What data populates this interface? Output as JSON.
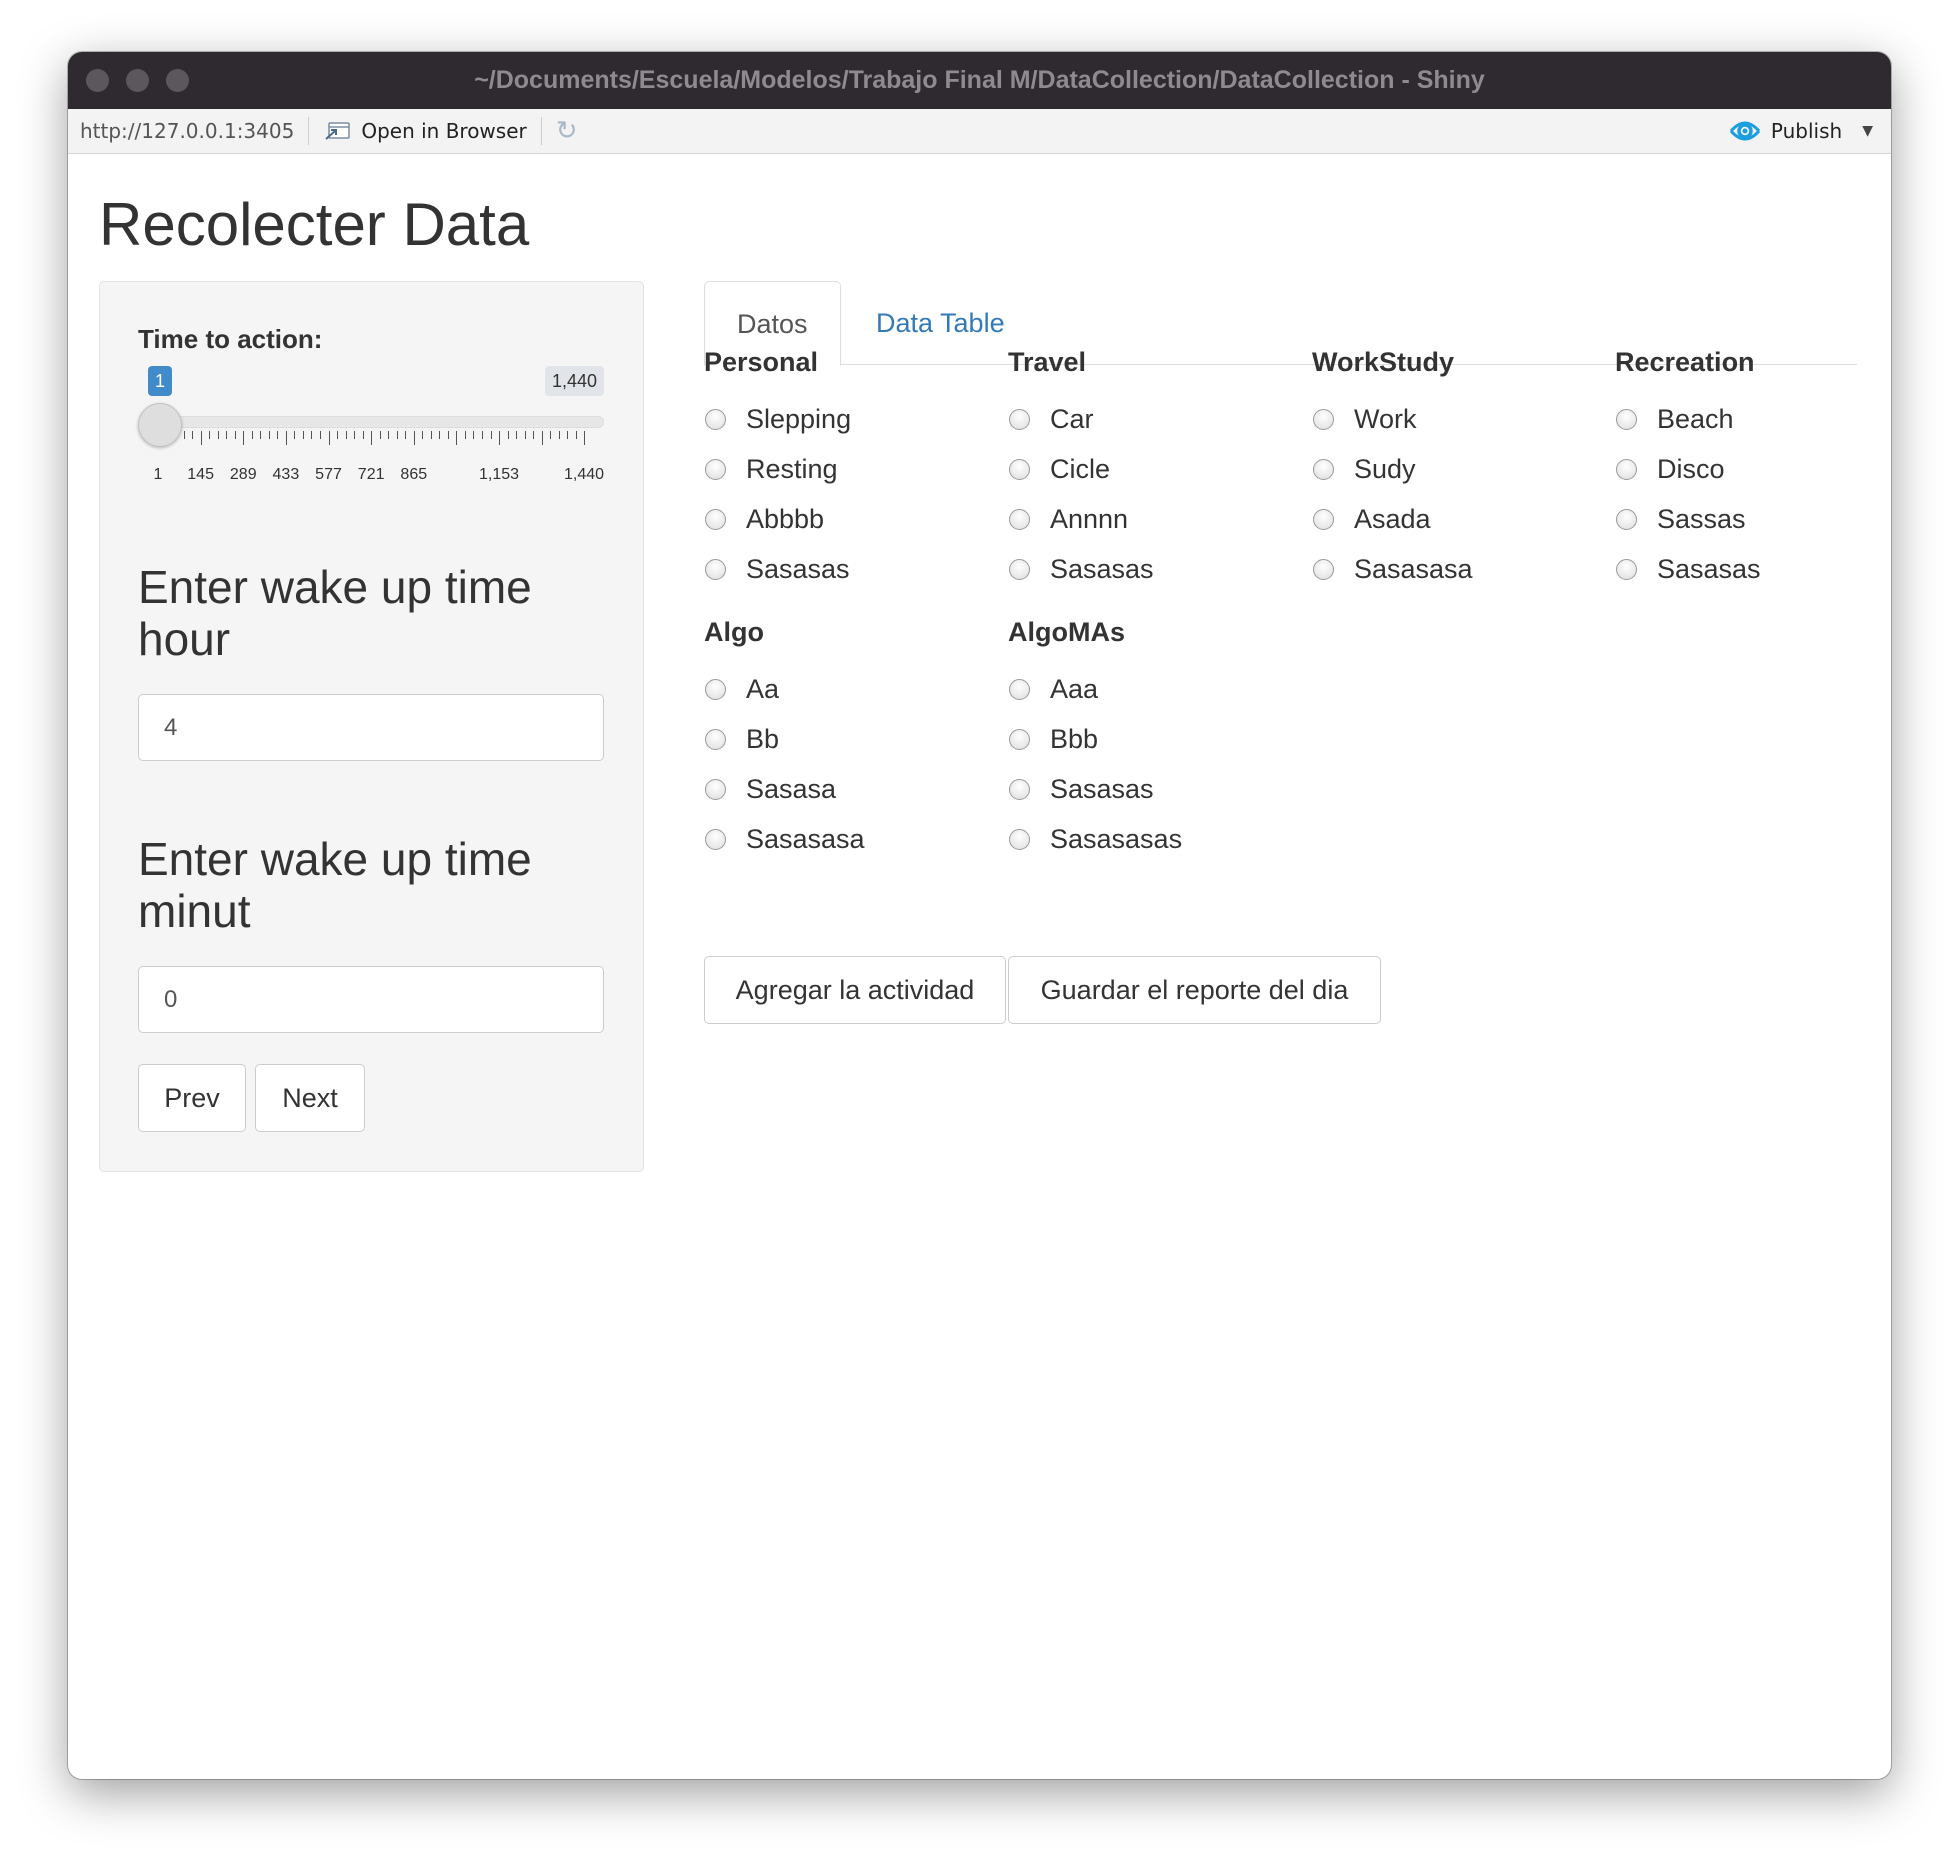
{
  "window": {
    "title": "~/Documents/Escuela/Modelos/Trabajo Final M/DataCollection/DataCollection - Shiny"
  },
  "toolbar": {
    "url": "http://127.0.0.1:3405",
    "open_in_browser": "Open in Browser",
    "publish": "Publish"
  },
  "app": {
    "title": "Recolecter Data"
  },
  "sidebar": {
    "slider": {
      "label": "Time to action:",
      "value_label": "1",
      "max_label": "1,440",
      "value": 1,
      "min": 1,
      "max": 1440,
      "tick_labels": [
        "1",
        "145",
        "289",
        "433",
        "577",
        "721",
        "865",
        "1,153",
        "1,440"
      ]
    },
    "hour_heading": "Enter wake up time hour",
    "hour_value": "4",
    "minute_heading": "Enter wake up time minut",
    "minute_value": "0",
    "prev_label": "Prev",
    "next_label": "Next"
  },
  "tabs": [
    {
      "label": "Datos",
      "active": true
    },
    {
      "label": "Data Table",
      "active": false
    }
  ],
  "groups": [
    {
      "title": "Personal",
      "options": [
        "Slepping",
        "Resting",
        "Abbbb",
        "Sasasas"
      ]
    },
    {
      "title": "Travel",
      "options": [
        "Car",
        "Cicle",
        "Annnn",
        "Sasasas"
      ]
    },
    {
      "title": "WorkStudy",
      "options": [
        "Work",
        "Sudy",
        "Asada",
        "Sasasasa"
      ]
    },
    {
      "title": "Recreation",
      "options": [
        "Beach",
        "Disco",
        "Sassas",
        "Sasasas"
      ]
    },
    {
      "title": "Algo",
      "options": [
        "Aa",
        "Bb",
        "Sasasa",
        "Sasasasa"
      ]
    },
    {
      "title": "AlgoMAs",
      "options": [
        "Aaa",
        "Bbb",
        "Sasasas",
        "Sasasasas"
      ]
    }
  ],
  "actions": {
    "add_label": "Agregar la actividad",
    "save_label": "Guardar el reporte del dia"
  },
  "colors": {
    "titlebar": "#2e2a30",
    "accent": "#428bca",
    "link": "#337ab7"
  }
}
